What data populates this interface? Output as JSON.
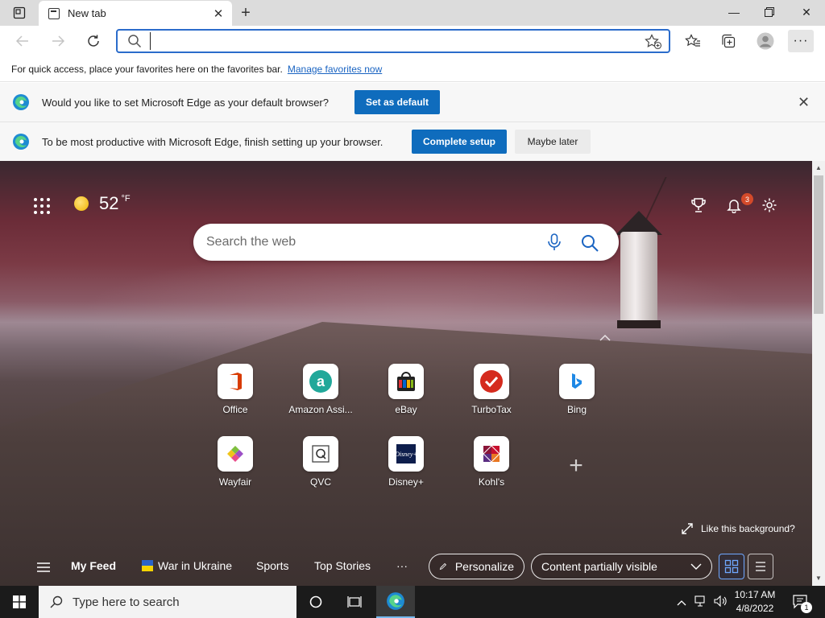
{
  "browser": {
    "tab": {
      "title": "New tab"
    },
    "address_bar": {
      "value": "",
      "placeholder": ""
    }
  },
  "favorites_bar": {
    "message": "For quick access, place your favorites here on the favorites bar.",
    "link": "Manage favorites now"
  },
  "infobar_default": {
    "message": "Would you like to set Microsoft Edge as your default browser?",
    "button": "Set as default"
  },
  "infobar_setup": {
    "message": "To be most productive with Microsoft Edge, finish setting up your browser.",
    "primary_button": "Complete setup",
    "secondary_button": "Maybe later"
  },
  "ntp": {
    "weather": {
      "temp": "52",
      "unit": "°F"
    },
    "notifications_count": "3",
    "search_placeholder": "Search the web",
    "tiles": [
      {
        "label": "Office",
        "icon": "office-icon"
      },
      {
        "label": "Amazon Assi...",
        "icon": "amazon-icon"
      },
      {
        "label": "eBay",
        "icon": "ebay-icon"
      },
      {
        "label": "TurboTax",
        "icon": "turbotax-icon"
      },
      {
        "label": "Bing",
        "icon": "bing-icon"
      },
      {
        "label": "Wayfair",
        "icon": "wayfair-icon"
      },
      {
        "label": "QVC",
        "icon": "qvc-icon"
      },
      {
        "label": "Disney+",
        "icon": "disney-icon"
      },
      {
        "label": "Kohl's",
        "icon": "kohls-icon"
      }
    ],
    "like_background": "Like this background?",
    "feed": {
      "tabs": [
        "My Feed",
        "War in Ukraine",
        "Sports",
        "Top Stories"
      ],
      "more": "···",
      "personalize": "Personalize",
      "content_visibility": "Content partially visible"
    }
  },
  "taskbar": {
    "search_placeholder": "Type here to search",
    "time": "10:17 AM",
    "date": "4/8/2022",
    "notification_count": "1"
  },
  "colors": {
    "accent": "#0f6cbd",
    "address_focus": "#2b6ccb",
    "link": "#1a64c2",
    "badge": "#d44a2a"
  }
}
